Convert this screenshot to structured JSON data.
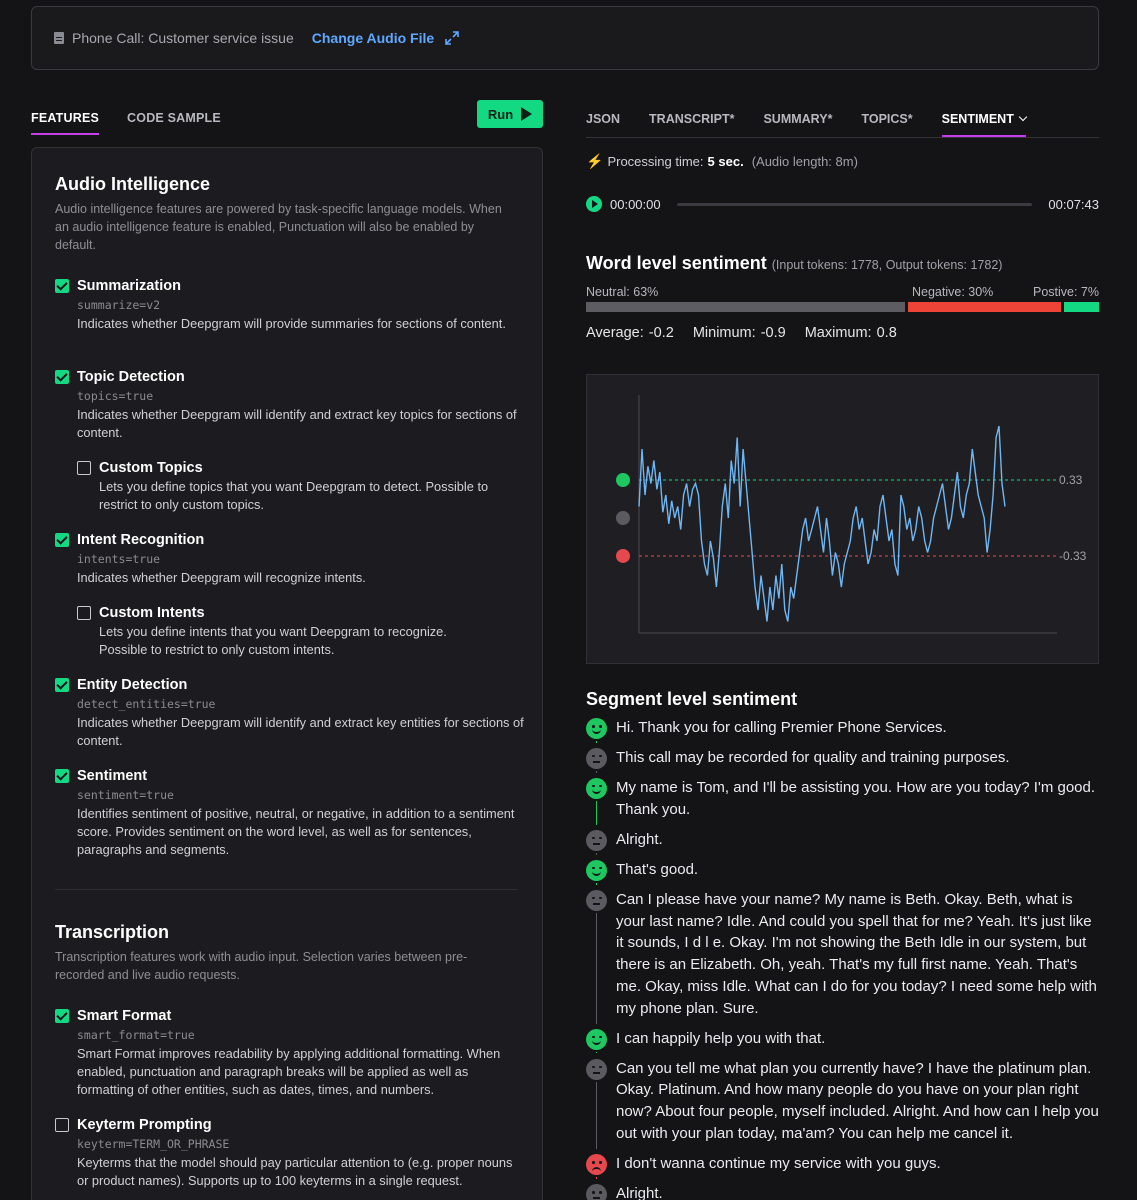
{
  "header": {
    "file_label": "Phone Call: Customer service issue",
    "change_label": "Change Audio File"
  },
  "left_tabs": [
    {
      "label": "FEATURES",
      "active": true
    },
    {
      "label": "CODE SAMPLE",
      "active": false
    }
  ],
  "run_label": "Run",
  "audio_intelligence": {
    "title": "Audio Intelligence",
    "description": "Audio intelligence features are powered by task-specific language models. When an audio intelligence feature is enabled, Punctuation will also be enabled by default.",
    "features": [
      {
        "name": "Summarization",
        "code": "summarize=v2",
        "desc": "Indicates whether Deepgram will provide summaries for sections of content.",
        "checked": true
      },
      {
        "name": "Topic Detection",
        "code": "topics=true",
        "desc": "Indicates whether Deepgram will identify and extract key topics for sections of content.",
        "checked": true
      },
      {
        "name": "Custom Topics",
        "code": "",
        "desc": "Lets you define topics that you want Deepgram to detect. Possible to restrict to only custom topics.",
        "checked": false
      },
      {
        "name": "Intent Recognition",
        "code": "intents=true",
        "desc": "Indicates whether Deepgram will recognize intents.",
        "checked": true
      },
      {
        "name": "Custom Intents",
        "code": "",
        "desc": "Lets you define intents that you want Deepgram to recognize. Possible to restrict to only custom intents.",
        "checked": false
      },
      {
        "name": "Entity Detection",
        "code": "detect_entities=true",
        "desc": "Indicates whether Deepgram will identify and extract key entities for sections of content.",
        "checked": true
      },
      {
        "name": "Sentiment",
        "code": "sentiment=true",
        "desc": "Identifies sentiment of positive, neutral, or negative, in addition to a sentiment score. Provides sentiment on the word level, as well as for sentences, paragraphs and segments.",
        "checked": true
      }
    ]
  },
  "transcription": {
    "title": "Transcription",
    "description": "Transcription features work with audio input. Selection varies between pre-recorded and live audio requests.",
    "features": [
      {
        "name": "Smart Format",
        "code": "smart_format=true",
        "desc": "Smart Format improves readability by applying additional formatting. When enabled, punctuation and paragraph breaks will be applied as well as formatting of other entities, such as dates, times, and numbers.",
        "checked": true
      },
      {
        "name": "Keyterm Prompting",
        "code": "keyterm=TERM_OR_PHRASE",
        "desc": "Keyterms that the model should pay particular attention to (e.g. proper nouns or product names). Supports up to 100 keyterms in a single request.",
        "checked": false
      }
    ]
  },
  "right_tabs": [
    {
      "label": "JSON",
      "active": false
    },
    {
      "label": "TRANSCRIPT*",
      "active": false
    },
    {
      "label": "SUMMARY*",
      "active": false
    },
    {
      "label": "TOPICS*",
      "active": false
    },
    {
      "label": "SENTIMENT",
      "active": true
    }
  ],
  "processing": {
    "label": "Processing time:",
    "value": "5 sec.",
    "audio_length": "(Audio length: 8m)"
  },
  "player": {
    "current": "00:00:00",
    "total": "00:07:43"
  },
  "word_level": {
    "title": "Word level sentiment",
    "tokens": "(Input tokens: 1778, Output tokens: 1782)",
    "neutral_label": "Neutral: 63%",
    "negative_label": "Negative: 30%",
    "positive_label": "Postive: 7%",
    "neutral_pct": 63,
    "negative_pct": 30,
    "positive_pct": 7,
    "colors": {
      "neutral": "#5c5c62",
      "negative": "#ee4438",
      "positive": "#13d982"
    },
    "average": "Average: -0.2",
    "minimum": "Minimum: -0.9",
    "maximum": "Maximum: 0.8"
  },
  "chart_data": {
    "type": "line",
    "series": [
      {
        "values": [
          0.1,
          0.6,
          0.2,
          0.45,
          0.3,
          0.5,
          0.25,
          0.4,
          0.05,
          0.2,
          -0.05,
          0.15,
          0.0,
          0.1,
          -0.1,
          0.2,
          0.3,
          0.1,
          0.25,
          0.3,
          0.2,
          -0.2,
          -0.4,
          -0.5,
          -0.2,
          -0.35,
          -0.6,
          -0.3,
          0.1,
          0.3,
          0.0,
          0.5,
          0.3,
          0.7,
          0.1,
          0.6,
          0.3,
          0.0,
          -0.3,
          -0.6,
          -0.8,
          -0.5,
          -0.7,
          -0.9,
          -0.6,
          -0.8,
          -0.5,
          -0.7,
          -0.4,
          -0.8,
          -0.9,
          -0.6,
          -0.7,
          -0.5,
          -0.3,
          -0.1,
          0.0,
          -0.2,
          -0.1,
          0.0,
          0.1,
          -0.1,
          -0.3,
          0.0,
          -0.2,
          -0.5,
          -0.3,
          -0.4,
          -0.6,
          -0.4,
          -0.3,
          -0.2,
          0.0,
          0.1,
          -0.1,
          0.0,
          -0.2,
          -0.4,
          -0.3,
          -0.1,
          -0.2,
          0.1,
          0.2,
          0.0,
          -0.2,
          -0.1,
          -0.4,
          -0.5,
          0.2,
          0.1,
          -0.1,
          0.0,
          -0.2,
          -0.1,
          0.1,
          0.0,
          -0.2,
          -0.3,
          -0.2,
          0.0,
          0.1,
          0.2,
          0.3,
          0.1,
          -0.1,
          0.0,
          0.2,
          0.4,
          0.1,
          0.0,
          0.2,
          0.3,
          0.6,
          0.4,
          0.2,
          0.1,
          0.0,
          -0.3,
          -0.1,
          0.2,
          0.7,
          0.8,
          0.3,
          0.1
        ]
      }
    ],
    "ylim": [
      -1,
      1
    ],
    "reference_lines": [
      {
        "value": 0.33,
        "label": "0.33",
        "color": "#13d982"
      },
      {
        "value": -0.33,
        "label": "-0.33",
        "color": "#e5484d"
      }
    ],
    "line_color": "#6fb6f2"
  },
  "segments_title": "Segment level sentiment",
  "segments": [
    {
      "sentiment": "pos",
      "text": "Hi. Thank you for calling Premier Phone Services."
    },
    {
      "sentiment": "neu",
      "text": "This call may be recorded for quality and training purposes."
    },
    {
      "sentiment": "pos",
      "text": "My name is Tom, and I'll be assisting you. How are you today? I'm good. Thank you."
    },
    {
      "sentiment": "neu",
      "text": "Alright."
    },
    {
      "sentiment": "pos",
      "text": "That's good."
    },
    {
      "sentiment": "neu",
      "text": "Can I please have your name? My name is Beth. Okay. Beth, what is your last name? Idle. And could you spell that for me? Yeah. It's just like it sounds, I d l e. Okay. I'm not showing the Beth Idle in our system, but there is an Elizabeth. Oh, yeah. That's my full first name. Yeah. That's me. Okay, miss Idle. What can I do for you today? I need some help with my phone plan. Sure."
    },
    {
      "sentiment": "pos",
      "text": "I can happily help you with that."
    },
    {
      "sentiment": "neu",
      "text": "Can you tell me what plan you currently have? I have the platinum plan. Okay. Platinum. And how many people do you have on your plan right now? About four people, myself included. Alright. And how can I help you out with your plan today, ma'am? You can help me cancel it."
    },
    {
      "sentiment": "neg",
      "text": "I don't wanna continue my service with you guys."
    },
    {
      "sentiment": "neu",
      "text": "Alright."
    }
  ]
}
